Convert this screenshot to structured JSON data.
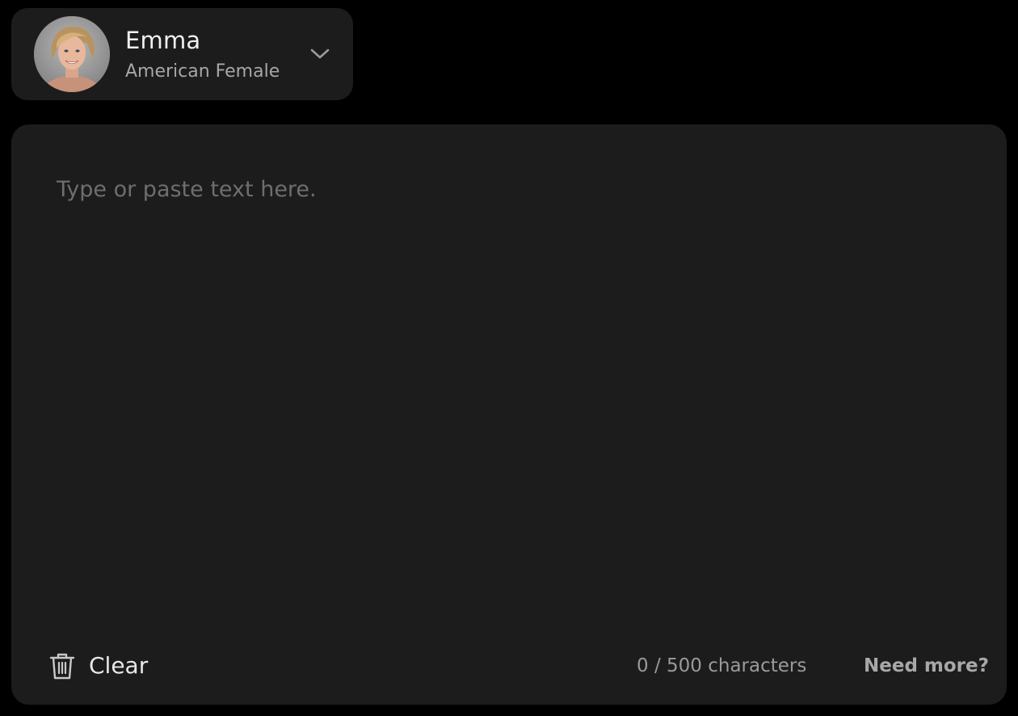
{
  "voice": {
    "name": "Emma",
    "description": "American Female",
    "avatar_icon": "portrait-avatar",
    "dropdown_icon": "chevron-down-icon"
  },
  "editor": {
    "placeholder": "Type or paste text here.",
    "value": ""
  },
  "footer": {
    "clear_label": "Clear",
    "clear_icon": "trash-icon",
    "char_count": "0 / 500 characters",
    "need_more_label": "Need more?"
  },
  "colors": {
    "page_background": "#000000",
    "panel_background": "#1c1c1c",
    "primary_text": "#f0f0f0",
    "secondary_text": "#a6a6a6",
    "placeholder_text": "#6e6e6e"
  }
}
